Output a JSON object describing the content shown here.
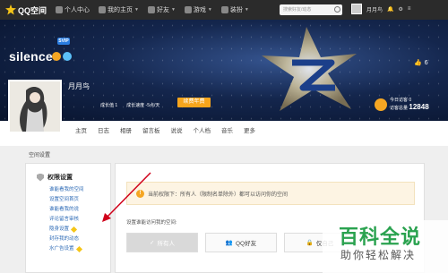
{
  "topbar": {
    "brand": "QQ空间",
    "nav": [
      "个人中心",
      "我的主页",
      "好友",
      "游戏",
      "装扮"
    ],
    "search_placeholder": "搜索好友/动态",
    "username": "月月鸟",
    "menu_label": "≡"
  },
  "banner": {
    "vip_badge": "SVIP",
    "title": "silence",
    "like_count": "6"
  },
  "profile": {
    "name": "月月鸟",
    "growth": "成长值 1",
    "speed": "成长速度 -5点/天",
    "renew_label": "续费年费",
    "today_label": "今日访客",
    "today_count": "0",
    "total_label": "访客总量",
    "total_count": "12848"
  },
  "tabs": [
    "主页",
    "日志",
    "相册",
    "留言板",
    "说说",
    "个人档",
    "音乐",
    "更多"
  ],
  "breadcrumb": "空间设置",
  "sidebar": {
    "title": "权限设置",
    "items": [
      "谁能看我的空间",
      "设置空间首页",
      "谁能看我的说",
      "评论留言审核",
      "隐身设置",
      "封存我的动态",
      "水广告设置"
    ]
  },
  "main": {
    "notice": "当前权限下：所有人（限制名单除外）都可以访问你的空间",
    "perm_label": "设置谁能访问我的空间:",
    "options": [
      "所有人",
      "QQ好友",
      "仅自己"
    ]
  },
  "watermark": {
    "line1": "百科全说",
    "line2": "助你轻松解决"
  },
  "colors": {
    "topbar": "#2b2b2b",
    "accent_orange": "#f7a51c",
    "link_blue": "#2e6bb6",
    "watermark_green": "#2aa24f",
    "arrow_red": "#d0021b"
  }
}
